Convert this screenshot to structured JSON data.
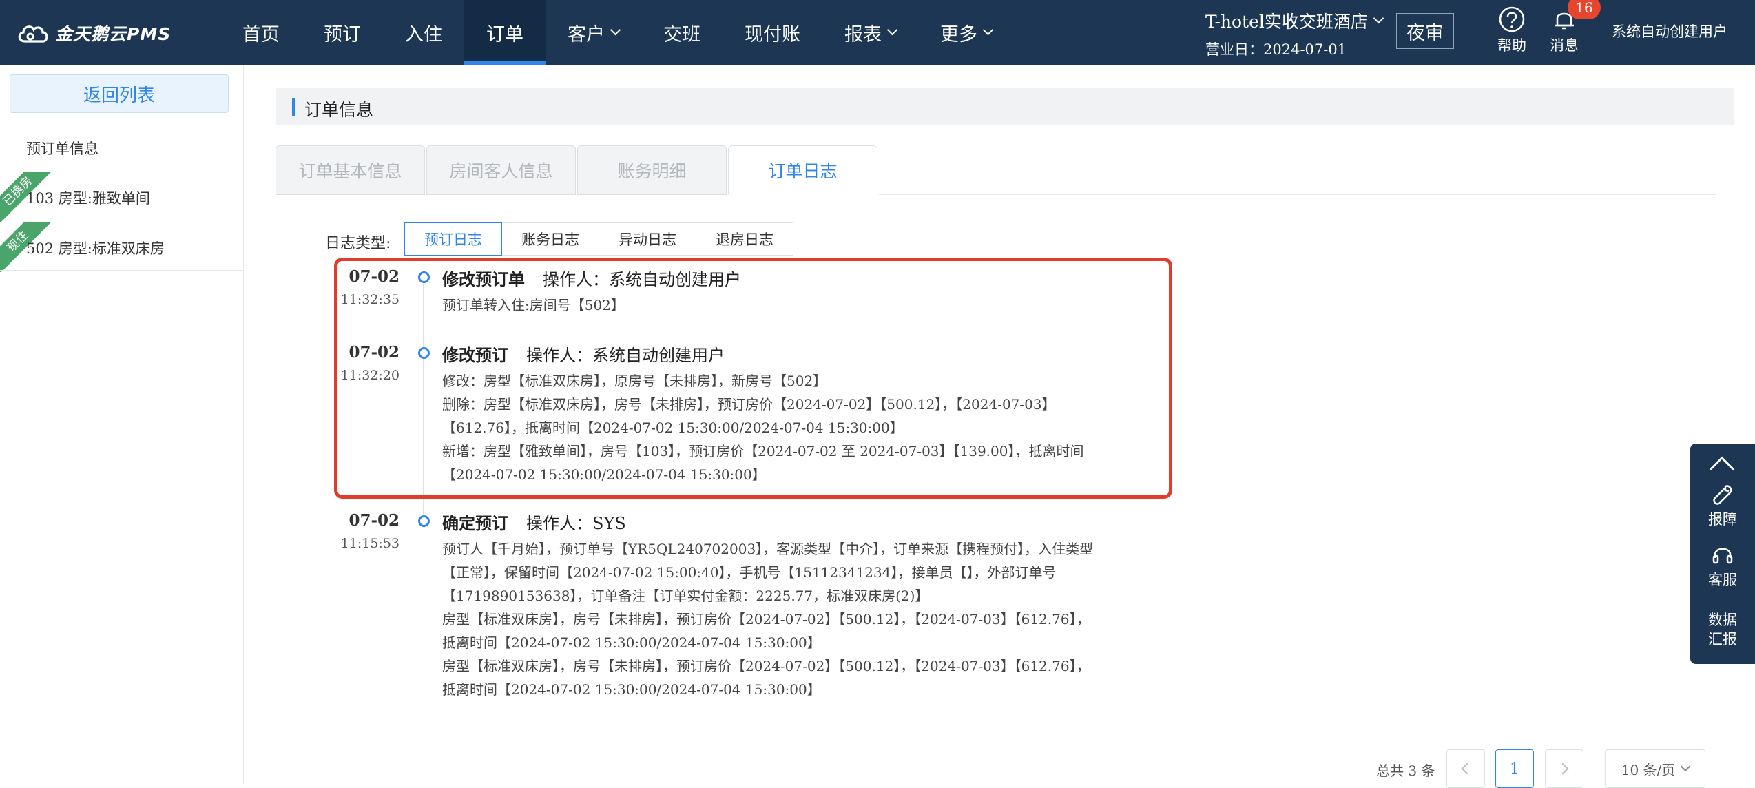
{
  "app": {
    "logo_text": "金天鹅云PMS"
  },
  "nav": {
    "items": [
      {
        "label": "首页",
        "dropdown": false,
        "active": false
      },
      {
        "label": "预订",
        "dropdown": false,
        "active": false
      },
      {
        "label": "入住",
        "dropdown": false,
        "active": false
      },
      {
        "label": "订单",
        "dropdown": false,
        "active": true
      },
      {
        "label": "客户",
        "dropdown": true,
        "active": false
      },
      {
        "label": "交班",
        "dropdown": false,
        "active": false
      },
      {
        "label": "现付账",
        "dropdown": false,
        "active": false
      },
      {
        "label": "报表",
        "dropdown": true,
        "active": false
      },
      {
        "label": "更多",
        "dropdown": true,
        "active": false
      }
    ]
  },
  "header": {
    "hotel_name": "T-hotel实收交班酒店",
    "business_date": "营业日：2024-07-01",
    "night_audit": "夜审",
    "help_label": "帮助",
    "message_label": "消息",
    "message_count": "16",
    "user_name": "系统自动创建用户"
  },
  "sidebar": {
    "back_label": "返回列表",
    "section_title": "预订单信息",
    "rooms": [
      {
        "tag": "已携房",
        "text": "103  房型:雅致单间"
      },
      {
        "tag": "现住",
        "text": "502  房型:标准双床房"
      }
    ]
  },
  "main": {
    "section_title": "订单信息",
    "tabs": [
      "订单基本信息",
      "房间客人信息",
      "账务明细",
      "订单日志"
    ],
    "active_tab": 3,
    "log_type_label": "日志类型:",
    "log_tabs": [
      "预订日志",
      "账务日志",
      "异动日志",
      "退房日志"
    ],
    "active_log_tab": 0,
    "entries": [
      {
        "date": "07-02",
        "time": "11:32:35",
        "title": "修改预订单",
        "operator": "操作人：系统自动创建用户",
        "lines": [
          "预订单转入住:房间号【502】"
        ]
      },
      {
        "date": "07-02",
        "time": "11:32:20",
        "title": "修改预订",
        "operator": "操作人：系统自动创建用户",
        "lines": [
          "修改：房型【标准双床房】，原房号【未排房】，新房号【502】",
          "删除：房型【标准双床房】，房号【未排房】，预订房价【2024-07-02】【500.12】，【2024-07-03】",
          "【612.76】，抵离时间【2024-07-02 15:30:00/2024-07-04 15:30:00】",
          "新增：房型【雅致单间】，房号【103】，预订房价【2024-07-02 至 2024-07-03】【139.00】，抵离时间",
          "【2024-07-02 15:30:00/2024-07-04 15:30:00】"
        ]
      },
      {
        "date": "07-02",
        "time": "11:15:53",
        "title": "确定预订",
        "operator": "操作人：SYS",
        "lines": [
          "预订人【千月始】，预订单号【YR5QL240702003】，客源类型【中介】，订单来源【携程预付】，入住类型",
          "【正常】，保留时间【2024-07-02 15:00:40】，手机号【15112341234】，接单员【】，外部订单号",
          "【1719890153638】，订单备注【订单实付金额：2225.77，标准双床房(2)】",
          "房型【标准双床房】，房号【未排房】，预订房价【2024-07-02】【500.12】，【2024-07-03】【612.76】，",
          "抵离时间【2024-07-02 15:30:00/2024-07-04 15:30:00】",
          "房型【标准双床房】，房号【未排房】，预订房价【2024-07-02】【500.12】，【2024-07-03】【612.76】，",
          "抵离时间【2024-07-02 15:30:00/2024-07-04 15:30:00】"
        ]
      }
    ]
  },
  "pagination": {
    "total": "总共 3 条",
    "current_page": "1",
    "page_size": "10 条/页"
  },
  "float_panel": {
    "report_label": "报障",
    "service_label": "客服",
    "data_label_1": "数据",
    "data_label_2": "汇报"
  },
  "colors": {
    "topbar": "#1c3653",
    "accent": "#2f86e8",
    "highlight_border": "#e03d2c",
    "badge": "#e8452e",
    "ribbon": "#4aa56a"
  }
}
